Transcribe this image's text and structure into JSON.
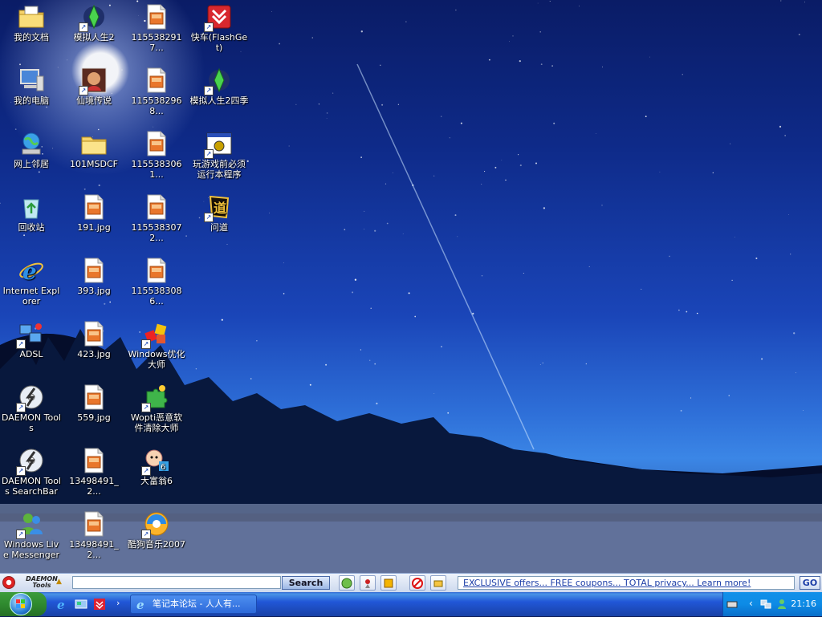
{
  "desktop_icons": [
    {
      "id": "my-documents",
      "label": "我的文档",
      "icon": "folder-documents-icon",
      "shortcut": false
    },
    {
      "id": "my-computer",
      "label": "我的电脑",
      "icon": "computer-icon",
      "shortcut": false
    },
    {
      "id": "network-places",
      "label": "网上邻居",
      "icon": "network-icon",
      "shortcut": false
    },
    {
      "id": "recycle-bin",
      "label": "回收站",
      "icon": "recycle-bin-icon",
      "shortcut": false
    },
    {
      "id": "internet-explorer",
      "label": "Internet Explorer",
      "icon": "ie-icon",
      "shortcut": false
    },
    {
      "id": "adsl",
      "label": "ADSL",
      "icon": "network-connection-icon",
      "shortcut": true
    },
    {
      "id": "daemon-tools",
      "label": "DAEMON Tools",
      "icon": "daemon-tools-icon",
      "shortcut": true
    },
    {
      "id": "daemon-tools-searchbar",
      "label": "DAEMON Tools SearchBar",
      "icon": "daemon-tools-icon",
      "shortcut": true
    },
    {
      "id": "windows-live-messenger",
      "label": "Windows Live Messenger",
      "icon": "messenger-icon",
      "shortcut": true
    },
    {
      "id": "sims2",
      "label": "模拟人生2",
      "icon": "sims-icon",
      "shortcut": true
    },
    {
      "id": "xianjing",
      "label": "仙境传说",
      "icon": "game-icon",
      "shortcut": true
    },
    {
      "id": "101msdcf",
      "label": "101MSDCF",
      "icon": "folder-icon",
      "shortcut": false
    },
    {
      "id": "jpg-191",
      "label": "191.jpg",
      "icon": "image-file-icon",
      "shortcut": false
    },
    {
      "id": "jpg-393",
      "label": "393.jpg",
      "icon": "image-file-icon",
      "shortcut": false
    },
    {
      "id": "jpg-423",
      "label": "423.jpg",
      "icon": "image-file-icon",
      "shortcut": false
    },
    {
      "id": "jpg-559",
      "label": "559.jpg",
      "icon": "image-file-icon",
      "shortcut": false
    },
    {
      "id": "jpg-13498491-a",
      "label": "13498491_2...",
      "icon": "image-file-icon",
      "shortcut": false
    },
    {
      "id": "jpg-13498491-b",
      "label": "13498491_2...",
      "icon": "image-file-icon",
      "shortcut": false
    },
    {
      "id": "jpg-1155382917",
      "label": "1155382917...",
      "icon": "image-file-icon",
      "shortcut": false
    },
    {
      "id": "jpg-1155382968",
      "label": "1155382968...",
      "icon": "image-file-icon",
      "shortcut": false
    },
    {
      "id": "jpg-1155383061",
      "label": "1155383061...",
      "icon": "image-file-icon",
      "shortcut": false
    },
    {
      "id": "jpg-1155383072",
      "label": "1155383072...",
      "icon": "image-file-icon",
      "shortcut": false
    },
    {
      "id": "jpg-1155383086",
      "label": "1155383086...",
      "icon": "image-file-icon",
      "shortcut": false
    },
    {
      "id": "windows-optimizer",
      "label": "Windows优化大师",
      "icon": "optimizer-icon",
      "shortcut": true
    },
    {
      "id": "wopti",
      "label": "Wopti恶意软件清除大师",
      "icon": "puzzle-icon",
      "shortcut": true
    },
    {
      "id": "richman6",
      "label": "大富翁6",
      "icon": "richman-icon",
      "shortcut": true
    },
    {
      "id": "kugou",
      "label": "酷狗音乐2007",
      "icon": "kugou-music-icon",
      "shortcut": true
    },
    {
      "id": "flashget",
      "label": "快车(FlashGet)",
      "icon": "flashget-icon",
      "shortcut": true
    },
    {
      "id": "sims2-seasons",
      "label": "模拟人生2四季",
      "icon": "sims-icon",
      "shortcut": true
    },
    {
      "id": "game-prereq",
      "label": "玩游戏前必须运行本程序",
      "icon": "program-window-icon",
      "shortcut": true
    },
    {
      "id": "wendao",
      "label": "问道",
      "icon": "wendao-icon",
      "shortcut": true
    }
  ],
  "searchbar": {
    "logo_line1": "DAEMON",
    "logo_line2": "Tools",
    "input_value": "",
    "search_label": "Search",
    "ad_text": "EXCLUSIVE offers... FREE coupons... TOTAL privacy... Learn more!",
    "go_label": "GO"
  },
  "taskbar": {
    "more_label": "›",
    "active_task_label": "笔记本论坛 - 人人有...",
    "clock": "21:16"
  },
  "colors": {
    "taskbar": "#2157d7",
    "tray": "#0d8be6",
    "start": "#2f8a2f",
    "link": "#1d3fa8"
  }
}
